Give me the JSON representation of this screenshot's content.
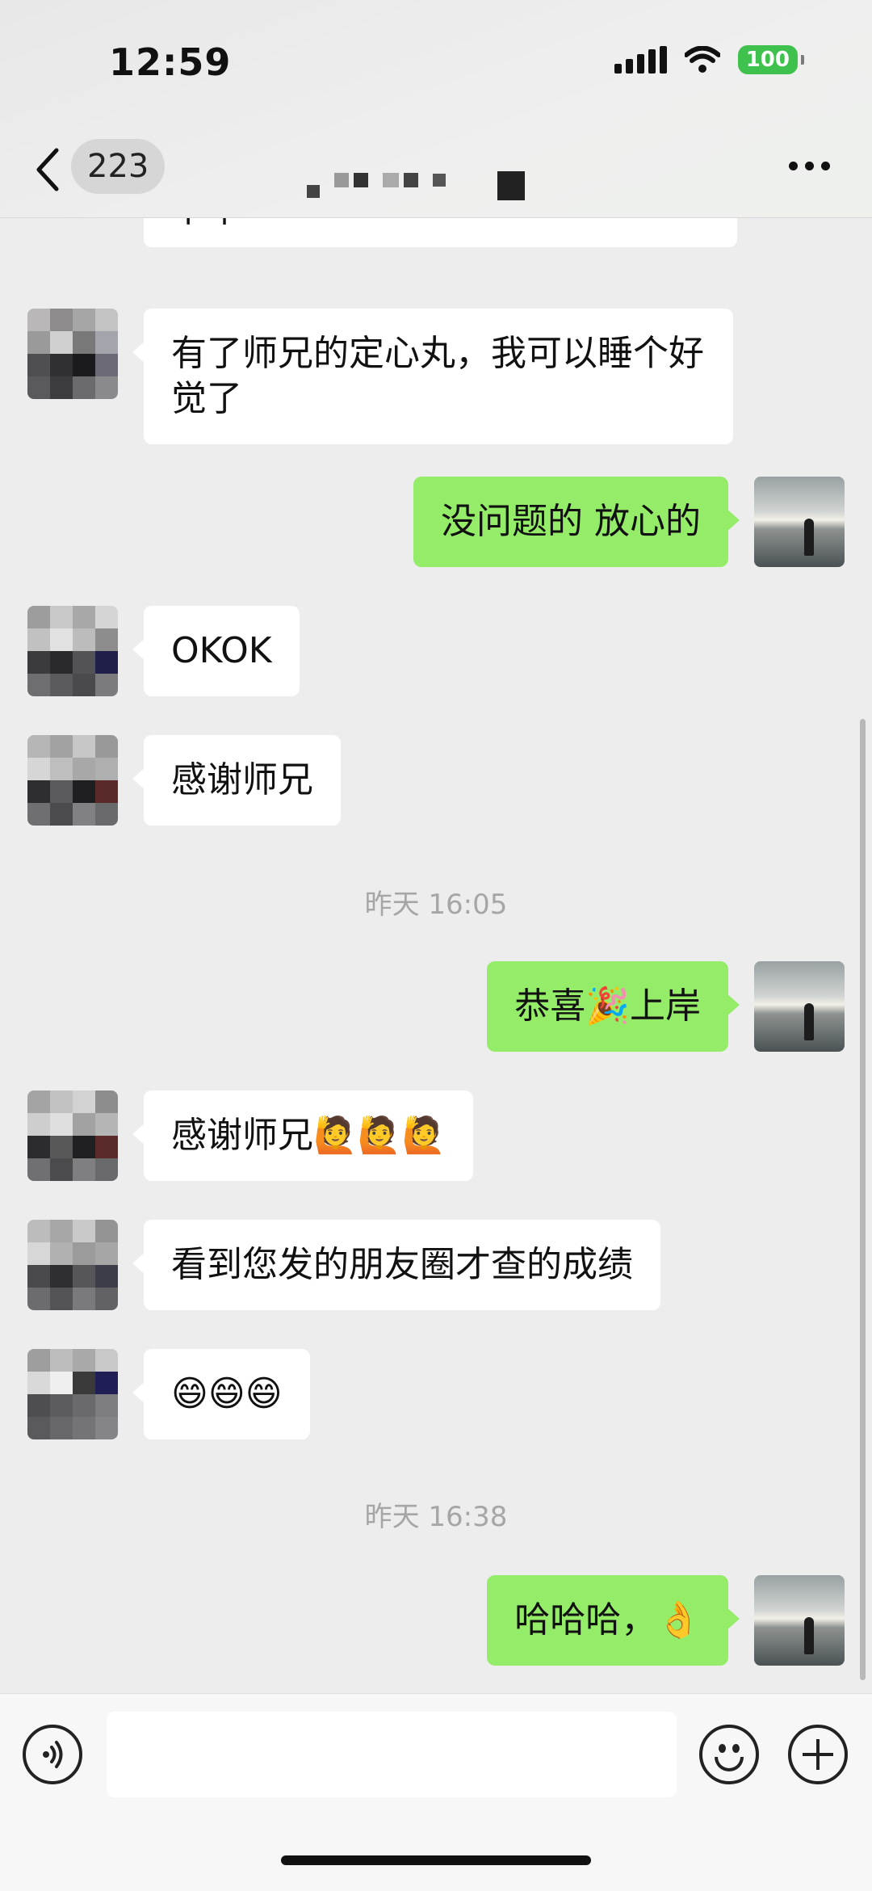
{
  "status_bar": {
    "time": "12:59",
    "battery": "100"
  },
  "header": {
    "unread_count": "223"
  },
  "messages": [
    {
      "side": "left",
      "text": "有了师兄的定心丸，我可以睡个好觉了"
    },
    {
      "side": "right",
      "text": "没问题的 放心的"
    },
    {
      "side": "left",
      "text": "OKOK"
    },
    {
      "side": "left",
      "text": "感谢师兄"
    },
    {
      "side": "right",
      "text": "恭喜🎉上岸"
    },
    {
      "side": "left",
      "text": "感谢师兄🙋🙋🙋"
    },
    {
      "side": "left",
      "text": "看到您发的朋友圈才查的成绩"
    },
    {
      "side": "left",
      "text": "😄😄😄"
    },
    {
      "side": "right",
      "text": "哈哈哈，👌"
    }
  ],
  "timestamps": [
    "昨天 16:05",
    "昨天 16:38"
  ],
  "partial_message": "下午",
  "input": {
    "placeholder": ""
  },
  "icons": {
    "back": "chevron-left-icon",
    "more": "more-dots-icon",
    "voice": "voice-icon",
    "emoji": "emoji-icon",
    "plus": "plus-icon"
  },
  "colors": {
    "my_bubble": "#95ec69",
    "other_bubble": "#ffffff",
    "background": "#ededed"
  }
}
